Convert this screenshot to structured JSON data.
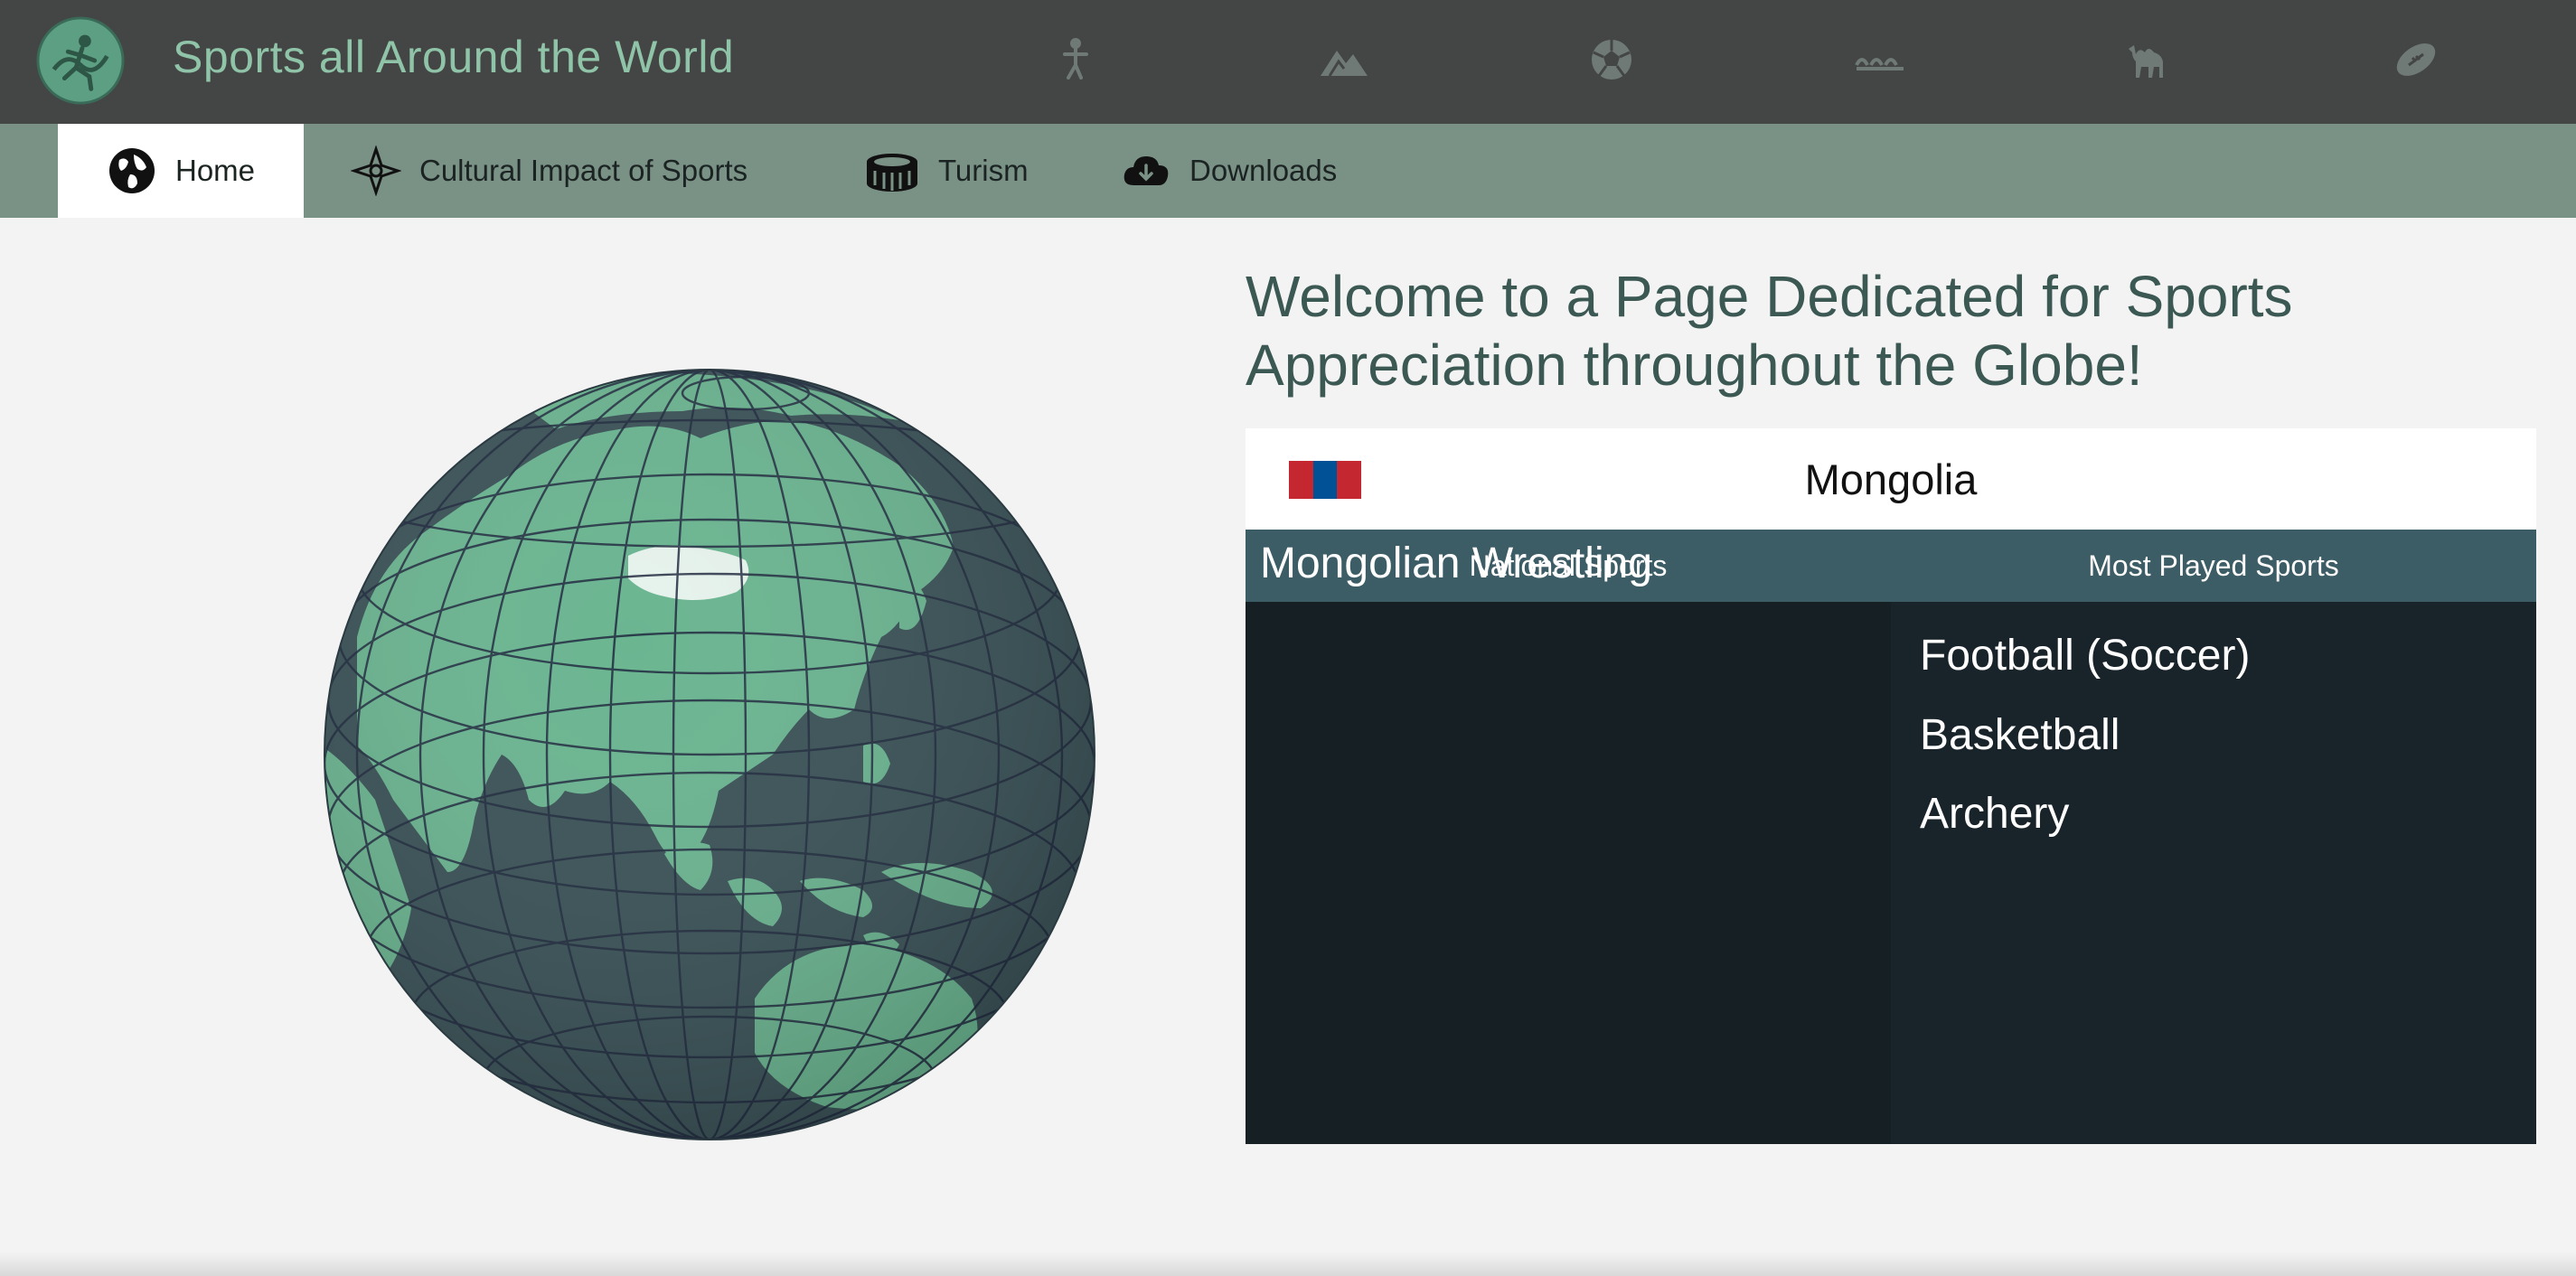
{
  "header": {
    "title": "Sports all Around the World",
    "logo_icon": "runner-globe-logo-icon",
    "sport_icons": [
      {
        "name": "gymnast-icon"
      },
      {
        "name": "mountains-icon"
      },
      {
        "name": "soccer-ball-icon"
      },
      {
        "name": "waves-icon"
      },
      {
        "name": "camel-icon"
      },
      {
        "name": "american-football-icon"
      }
    ]
  },
  "nav": {
    "items": [
      {
        "label": "Home",
        "icon": "globe-icon",
        "active": true
      },
      {
        "label": "Cultural Impact of Sports",
        "icon": "compass-ornament-icon",
        "active": false
      },
      {
        "label": "Turism",
        "icon": "stadium-icon",
        "active": false
      },
      {
        "label": "Downloads",
        "icon": "cloud-download-icon",
        "active": false
      }
    ]
  },
  "main": {
    "welcome": "Welcome to a Page Dedicated for Sports Appreciation throughout the Globe!",
    "country": {
      "name": "Mongolia",
      "flag_colors": [
        "#c4272f",
        "#015197",
        "#c4272f"
      ]
    },
    "national_sports": {
      "header": "National Sports",
      "items": [
        "Mongolian Wrestling"
      ]
    },
    "most_played": {
      "header": "Most Played Sports",
      "items": [
        "Football (Soccer)",
        "Basketball",
        "Archery"
      ]
    }
  },
  "colors": {
    "topbar": "#444645",
    "navbar": "#7a9186",
    "land": "#6bb591",
    "ocean": "#3b5358",
    "highlight": "#e6f2ec",
    "table_header": "#3c5c66"
  }
}
